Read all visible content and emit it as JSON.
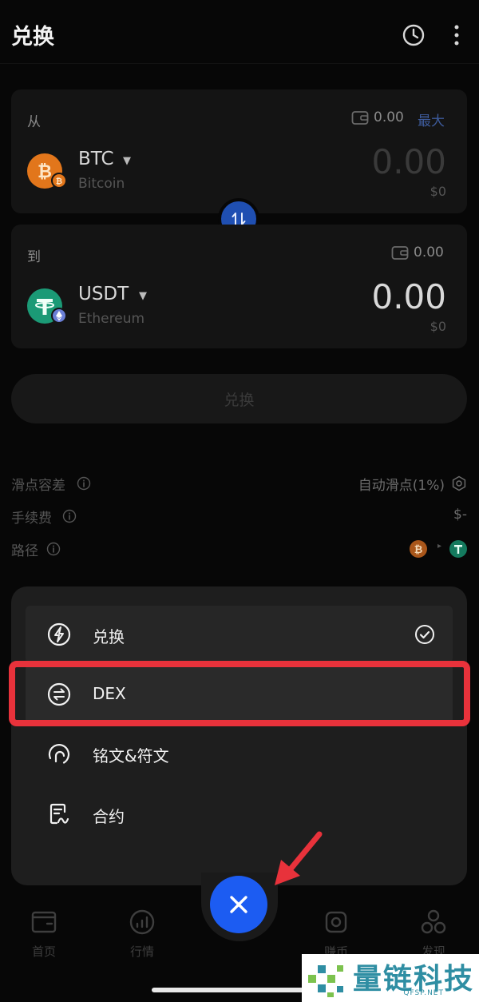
{
  "header": {
    "title": "兑换",
    "history_icon": "clock-icon",
    "more_icon": "more-vertical-icon"
  },
  "from": {
    "label": "从",
    "balance": "0.00",
    "max_label": "最大",
    "token": "BTC",
    "chain": "Bitcoin",
    "amount": "0.00",
    "usd": "$0"
  },
  "to": {
    "label": "到",
    "balance": "0.00",
    "token": "USDT",
    "chain": "Ethereum",
    "amount": "0.00",
    "usd": "$0"
  },
  "swap_button": {
    "label": "兑换"
  },
  "details": {
    "slippage": {
      "label": "滑点容差",
      "value": "自动滑点(1%)"
    },
    "fee": {
      "label": "手续费",
      "value": "$-"
    },
    "route": {
      "label": "路径"
    }
  },
  "menu": {
    "items": [
      {
        "label": "兑换",
        "icon": "lightning-circle-icon",
        "selected": true
      },
      {
        "label": "DEX",
        "icon": "swap-arrows-circle-icon",
        "highlighted": true
      },
      {
        "label": "铭文&符文",
        "icon": "inscription-icon"
      },
      {
        "label": "合约",
        "icon": "contract-icon"
      }
    ]
  },
  "bottom_nav": {
    "items": [
      {
        "label": "首页",
        "icon": "wallet-icon"
      },
      {
        "label": "行情",
        "icon": "chart-gauge-icon"
      },
      {
        "label": "赚币",
        "icon": "earn-icon"
      },
      {
        "label": "发现",
        "icon": "discover-icon"
      }
    ],
    "close_icon": "close-icon"
  },
  "watermark": {
    "title": "量链科技",
    "subtitle": "QFSP.NET"
  },
  "colors": {
    "accent_blue": "#1c5cf2",
    "highlight_red": "#e8323b",
    "btc_orange": "#e2761b",
    "usdt_green": "#1b9a76",
    "max_link": "#3d5a9a"
  }
}
